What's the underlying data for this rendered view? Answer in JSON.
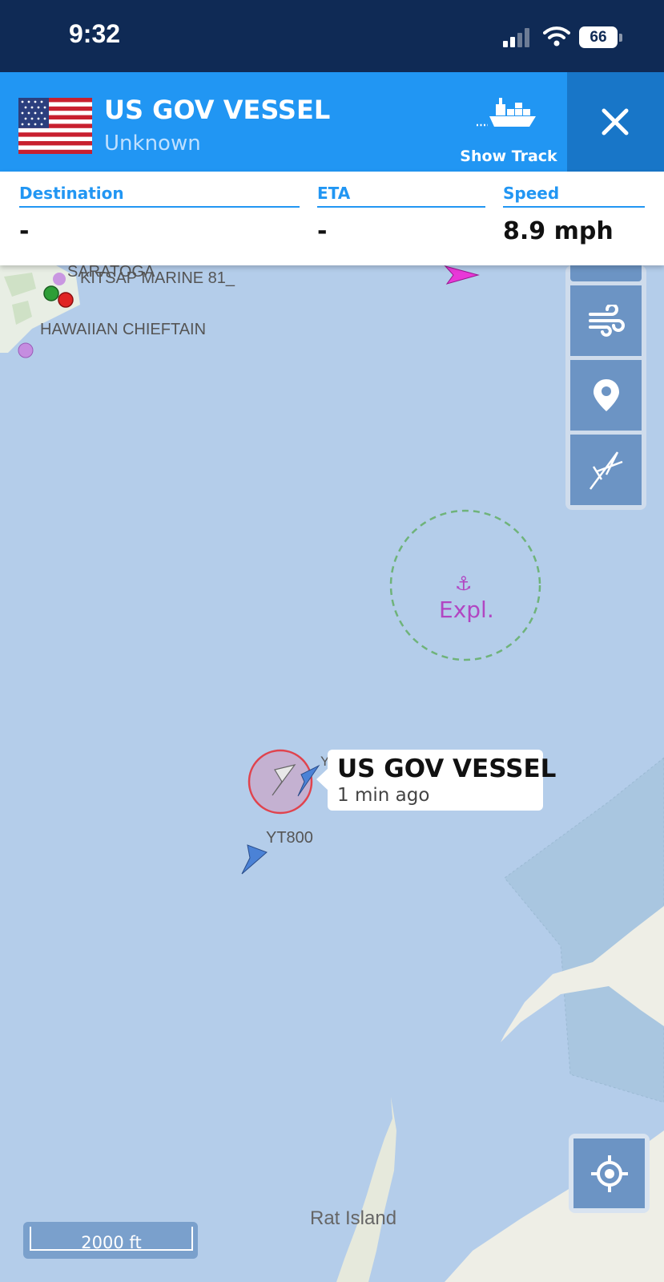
{
  "status_bar": {
    "time": "9:32",
    "battery": "66"
  },
  "header": {
    "vessel_name": "US GOV VESSEL",
    "vessel_type": "Unknown",
    "show_track_label": "Show Track"
  },
  "info": {
    "destination_label": "Destination",
    "destination_value": "-",
    "eta_label": "ETA",
    "eta_value": "-",
    "speed_label": "Speed",
    "speed_value": "8.9 mph"
  },
  "map": {
    "labels": {
      "top_overlap_1": "SARATOGA",
      "top_overlap_2": "KITSAP MARINE 81_",
      "hawaiian": "HAWAIIAN CHIEFTAIN",
      "anchorage": "Expl.",
      "yt800": "YT800",
      "y_label": "Y",
      "rat_island": "Rat Island"
    },
    "callout": {
      "name": "US GOV VESSEL",
      "time": "1 min ago"
    },
    "scale": "2000 ft"
  },
  "icons": [
    "wifi-icon",
    "battery-icon",
    "cargo-ship-icon",
    "close-icon",
    "wind-icon",
    "map-pin-icon",
    "compass-icon",
    "locate-icon",
    "anchor-icon"
  ],
  "colors": {
    "header_blue": "#2196f3",
    "close_blue": "#1876c8",
    "status_navy": "#0f2a55",
    "water": "#b4cdea"
  }
}
